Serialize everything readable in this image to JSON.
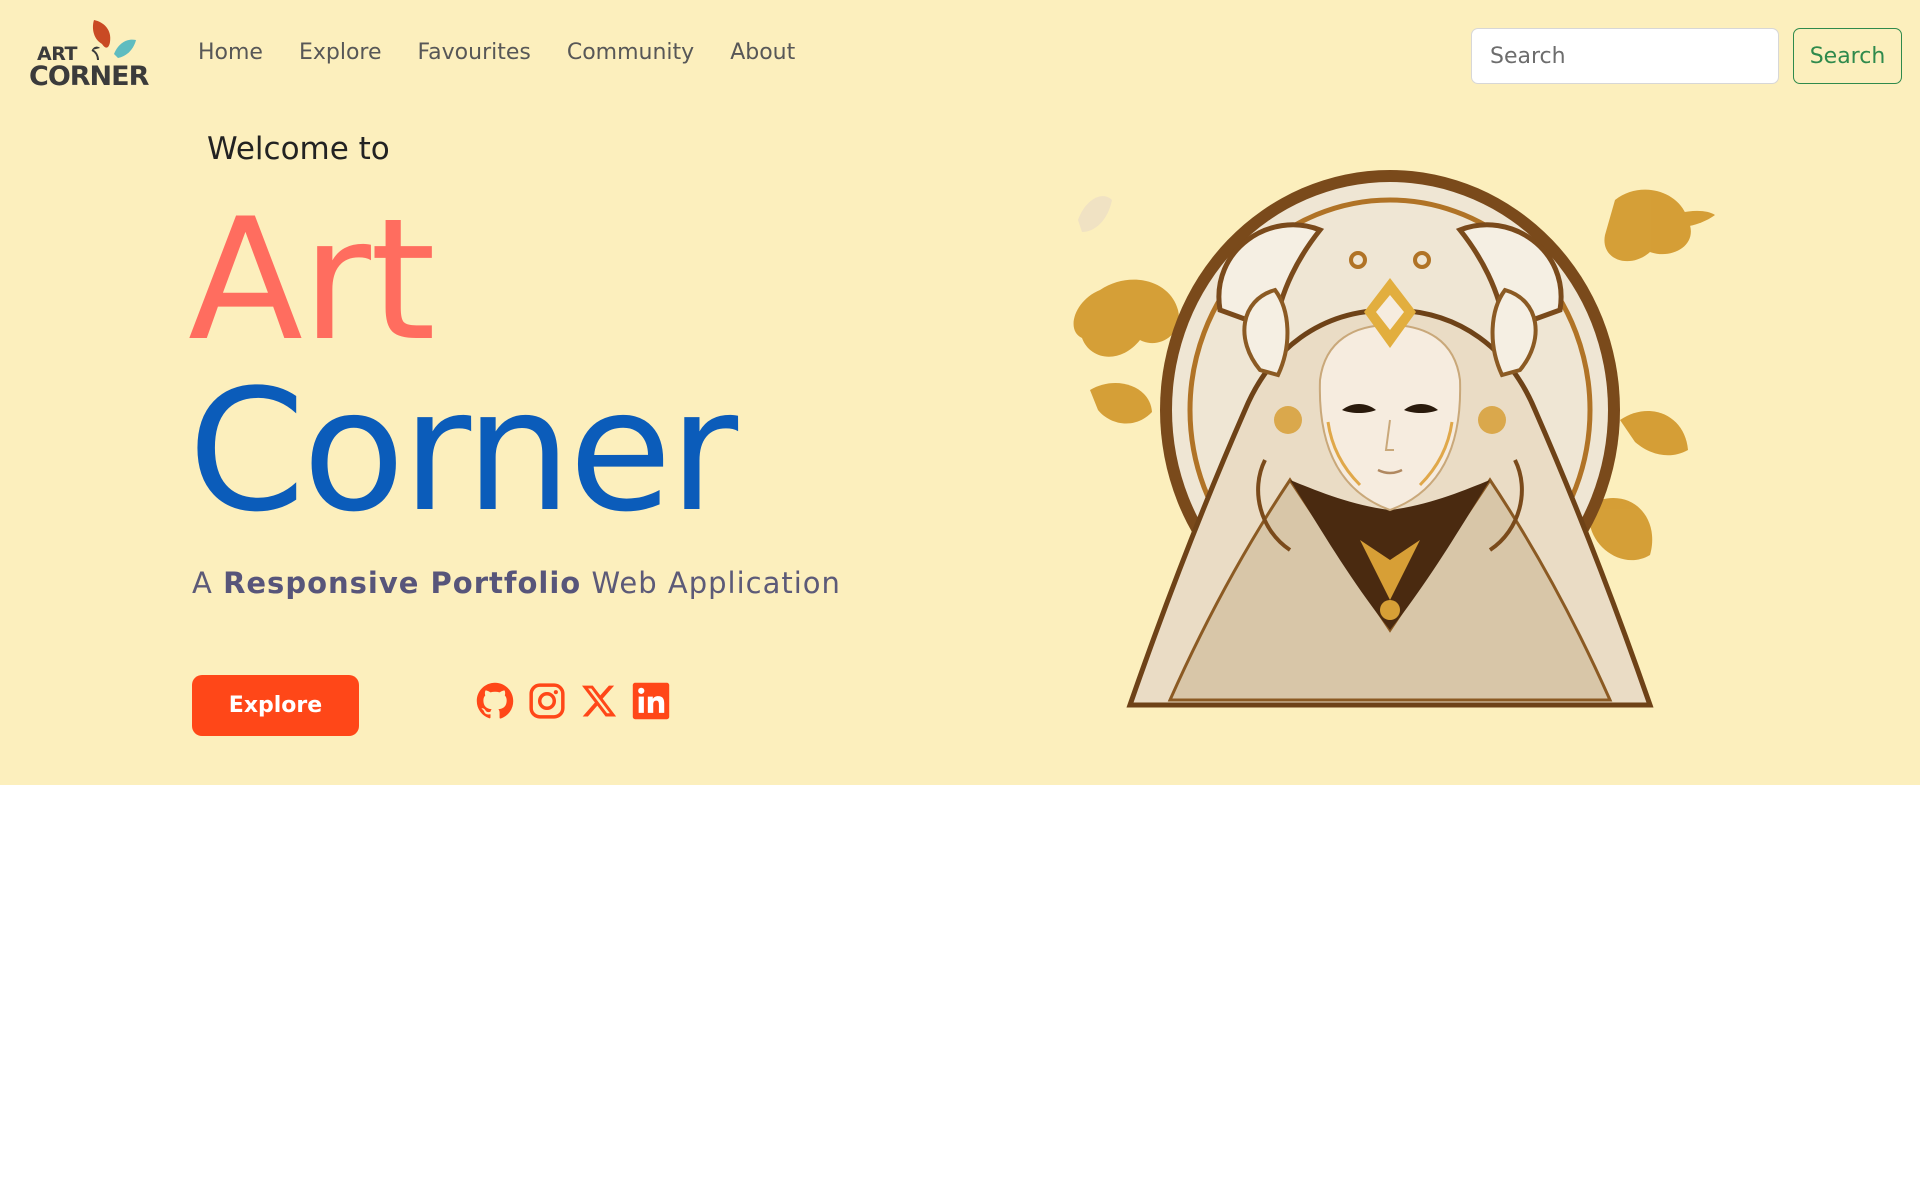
{
  "brand": {
    "logo_top": "ART",
    "logo_bottom": "CORNER",
    "colors": {
      "leaf_red": "#c94a24",
      "leaf_teal": "#5fbcc0",
      "text": "#3b3b3b"
    }
  },
  "nav": {
    "links": [
      "Home",
      "Explore",
      "Favourites",
      "Community",
      "About"
    ]
  },
  "search": {
    "placeholder": "Search",
    "value": "",
    "button_label": "Search"
  },
  "hero": {
    "welcome": "Welcome to",
    "title_line1": "Art",
    "title_line2": "Corner",
    "tagline_prefix": "A",
    "tagline_bold": "Responsive Portfolio",
    "tagline_suffix": "Web Application",
    "explore_label": "Explore",
    "socials": [
      {
        "name": "github-icon"
      },
      {
        "name": "instagram-icon"
      },
      {
        "name": "x-twitter-icon"
      },
      {
        "name": "linkedin-icon"
      }
    ],
    "colors": {
      "background": "#fcefbd",
      "art": "#ff6d5f",
      "corner": "#0b5cba",
      "button": "#ff4718",
      "social": "#ff4718"
    },
    "illustration": "ornate-masked-figure-illustration"
  }
}
